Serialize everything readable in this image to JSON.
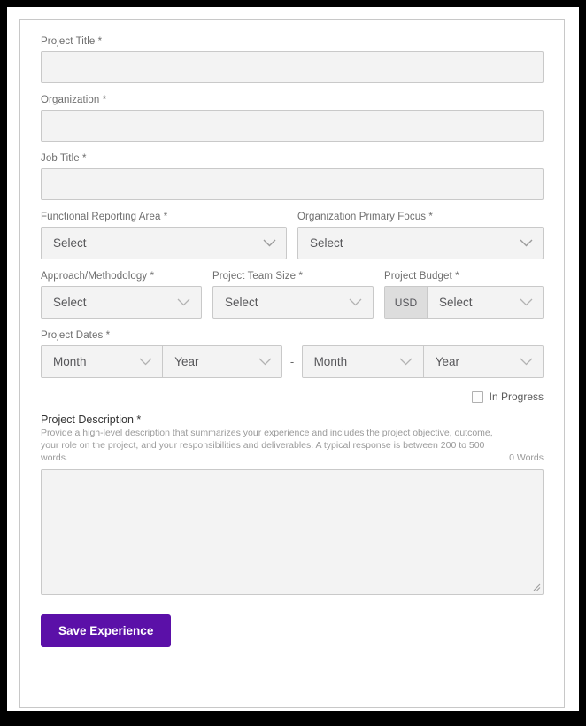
{
  "form": {
    "project_title": {
      "label": "Project Title *",
      "value": "",
      "placeholder": ""
    },
    "organization": {
      "label": "Organization *",
      "value": "",
      "placeholder": ""
    },
    "job_title": {
      "label": "Job Title *",
      "value": "",
      "placeholder": ""
    },
    "functional_reporting_area": {
      "label": "Functional Reporting Area *",
      "value": "Select"
    },
    "organization_primary_focus": {
      "label": "Organization Primary Focus *",
      "value": "Select"
    },
    "approach_methodology": {
      "label": "Approach/Methodology *",
      "value": "Select"
    },
    "project_team_size": {
      "label": "Project Team Size *",
      "value": "Select"
    },
    "project_budget": {
      "label": "Project Budget *",
      "currency": "USD",
      "value": "Select"
    },
    "project_dates": {
      "label": "Project Dates *",
      "separator": "-",
      "start_month": "Month",
      "start_year": "Year",
      "end_month": "Month",
      "end_year": "Year"
    },
    "in_progress": {
      "label": "In Progress",
      "checked": false
    },
    "project_description": {
      "label": "Project Description *",
      "helper": "Provide a high-level description that summarizes your experience and includes the project objective, outcome, your role on the project, and your responsibilities and deliverables. A typical response is between 200 to 500 words.",
      "word_count": "0 Words",
      "value": "",
      "placeholder": ""
    },
    "save_button": {
      "label": "Save Experience"
    }
  },
  "theme": {
    "accent": "#5b10a8",
    "input_bg": "#f3f3f3",
    "input_border": "#c9c9c9",
    "label_color": "#6e6e6e",
    "prefix_bg": "#dddddd"
  }
}
